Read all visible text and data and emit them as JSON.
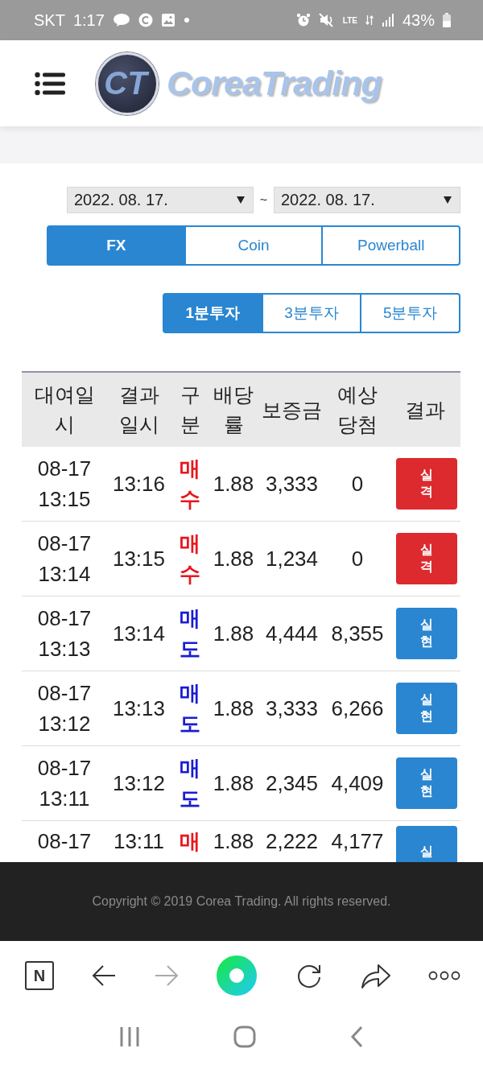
{
  "status_bar": {
    "carrier": "SKT",
    "time": "1:17",
    "network": "LTE",
    "battery": "43%"
  },
  "header": {
    "logo_mark": "CT",
    "logo_text": "CoreaTrading"
  },
  "date_range": {
    "from": "2022. 08. 17.",
    "separator": "~",
    "to": "2022. 08. 17."
  },
  "market_tabs": [
    {
      "label": "FX",
      "selected": true
    },
    {
      "label": "Coin",
      "selected": false
    },
    {
      "label": "Powerball",
      "selected": false
    }
  ],
  "period_tabs": [
    {
      "label": "1분투자",
      "selected": true
    },
    {
      "label": "3분투자",
      "selected": false
    },
    {
      "label": "5분투자",
      "selected": false
    }
  ],
  "table": {
    "columns": [
      "대여일시",
      "결과일시",
      "구분",
      "배당률",
      "보증금",
      "예상당첨",
      "결과"
    ],
    "rows": [
      {
        "rent_time": "08-17 13:15",
        "result_time": "13:16",
        "side": {
          "text": "매수",
          "kind": "buy"
        },
        "rate": "1.88",
        "deposit": "3,333",
        "expected": "0",
        "result": {
          "text": "실격",
          "kind": "loss"
        }
      },
      {
        "rent_time": "08-17 13:14",
        "result_time": "13:15",
        "side": {
          "text": "매수",
          "kind": "buy"
        },
        "rate": "1.88",
        "deposit": "1,234",
        "expected": "0",
        "result": {
          "text": "실격",
          "kind": "loss"
        }
      },
      {
        "rent_time": "08-17 13:13",
        "result_time": "13:14",
        "side": {
          "text": "매도",
          "kind": "sell"
        },
        "rate": "1.88",
        "deposit": "4,444",
        "expected": "8,355",
        "result": {
          "text": "실현",
          "kind": "win"
        }
      },
      {
        "rent_time": "08-17 13:12",
        "result_time": "13:13",
        "side": {
          "text": "매도",
          "kind": "sell"
        },
        "rate": "1.88",
        "deposit": "3,333",
        "expected": "6,266",
        "result": {
          "text": "실현",
          "kind": "win"
        }
      },
      {
        "rent_time": "08-17 13:11",
        "result_time": "13:12",
        "side": {
          "text": "매도",
          "kind": "sell"
        },
        "rate": "1.88",
        "deposit": "2,345",
        "expected": "4,409",
        "result": {
          "text": "실현",
          "kind": "win"
        }
      },
      {
        "rent_time": "08-17",
        "result_time": "13:11",
        "side": {
          "text": "매",
          "kind": "buy"
        },
        "rate": "1.88",
        "deposit": "2,222",
        "expected": "4,177",
        "result": {
          "text": "실",
          "kind": "win"
        }
      }
    ]
  },
  "footer": {
    "copyright": "Copyright © 2019 Corea Trading. All rights reserved."
  },
  "browser_bar": {
    "home_key": "N"
  }
}
